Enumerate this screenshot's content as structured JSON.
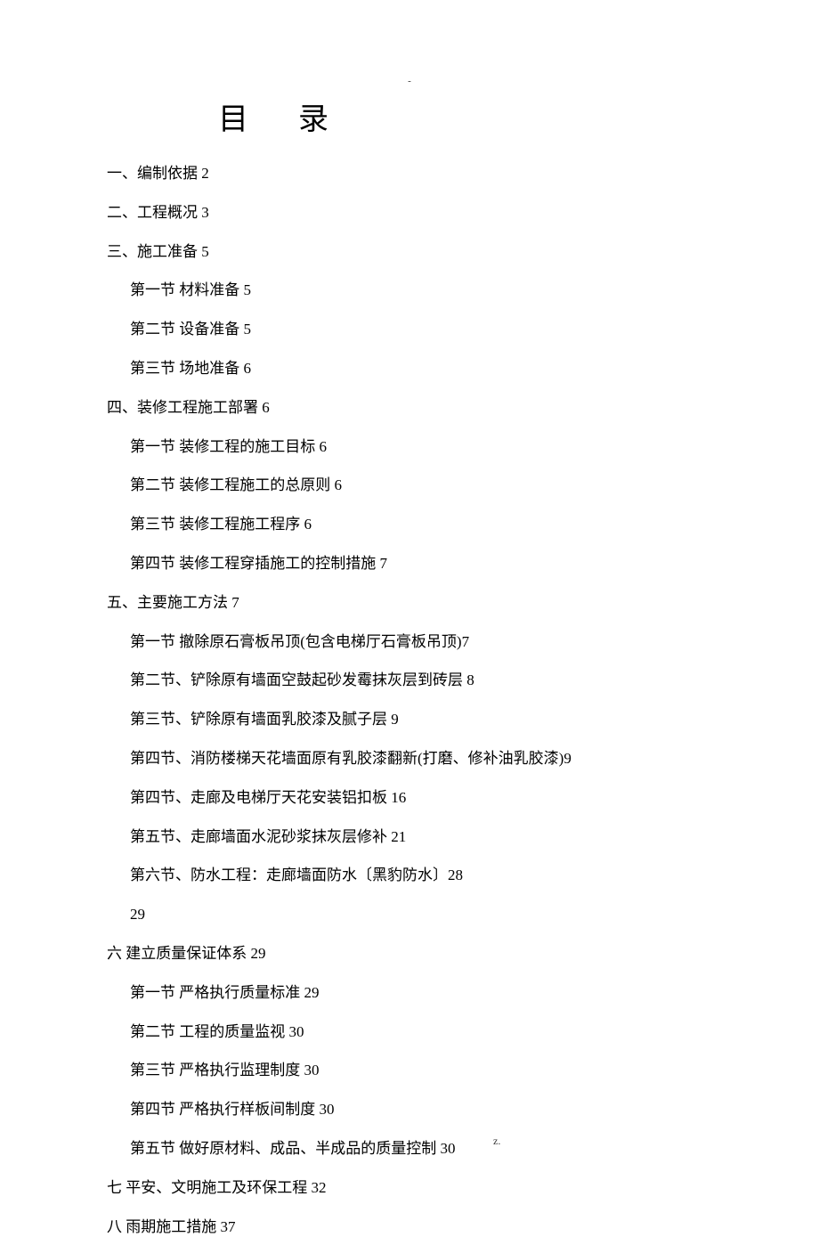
{
  "topMark": "-",
  "title": {
    "a": "目",
    "b": "录"
  },
  "toc": [
    {
      "level": 1,
      "text": "一、编制依据 2"
    },
    {
      "level": 1,
      "text": "二、工程概况 3"
    },
    {
      "level": 1,
      "text": "三、施工准备 5"
    },
    {
      "level": 2,
      "text": "第一节  材料准备 5"
    },
    {
      "level": 2,
      "text": "第二节  设备准备 5"
    },
    {
      "level": 2,
      "text": "第三节  场地准备 6"
    },
    {
      "level": 1,
      "text": "四、装修工程施工部署 6"
    },
    {
      "level": 2,
      "text": "第一节  装修工程的施工目标 6"
    },
    {
      "level": 2,
      "text": "第二节  装修工程施工的总原则 6"
    },
    {
      "level": 2,
      "text": "第三节  装修工程施工程序 6"
    },
    {
      "level": 2,
      "text": "第四节  装修工程穿插施工的控制措施 7"
    },
    {
      "level": 1,
      "text": "五、主要施工方法 7"
    },
    {
      "level": 2,
      "text": "第一节  撤除原石膏板吊顶(包含电梯厅石膏板吊顶)7"
    },
    {
      "level": 2,
      "text": "第二节、铲除原有墙面空鼓起砂发霉抹灰层到砖层 8"
    },
    {
      "level": 2,
      "text": "第三节、铲除原有墙面乳胶漆及腻子层 9"
    },
    {
      "level": 2,
      "text": "第四节、消防楼梯天花墙面原有乳胶漆翻新(打磨、修补油乳胶漆)9"
    },
    {
      "level": 2,
      "text": "第四节、走廊及电梯厅天花安装铝扣板 16"
    },
    {
      "level": 2,
      "text": "第五节、走廊墙面水泥砂浆抹灰层修补 21"
    },
    {
      "level": 2,
      "text": "第六节、防水工程：走廊墙面防水〔黑豹防水〕28"
    },
    {
      "level": 2,
      "text": "29"
    },
    {
      "level": 1,
      "text": "六  建立质量保证体系 29"
    },
    {
      "level": 2,
      "text": "第一节  严格执行质量标准 29"
    },
    {
      "level": 2,
      "text": "第二节    工程的质量监视 30"
    },
    {
      "level": 2,
      "text": "第三节  严格执行监理制度 30"
    },
    {
      "level": 2,
      "text": "第四节  严格执行样板间制度 30"
    },
    {
      "level": 2,
      "text": "第五节  做好原材料、成品、半成品的质量控制 30"
    },
    {
      "level": 1,
      "text": "七  平安、文明施工及环保工程 32"
    },
    {
      "level": 1,
      "text": "八  雨期施工措施 37"
    }
  ],
  "footer": {
    "dot": ".",
    "z": "z."
  }
}
